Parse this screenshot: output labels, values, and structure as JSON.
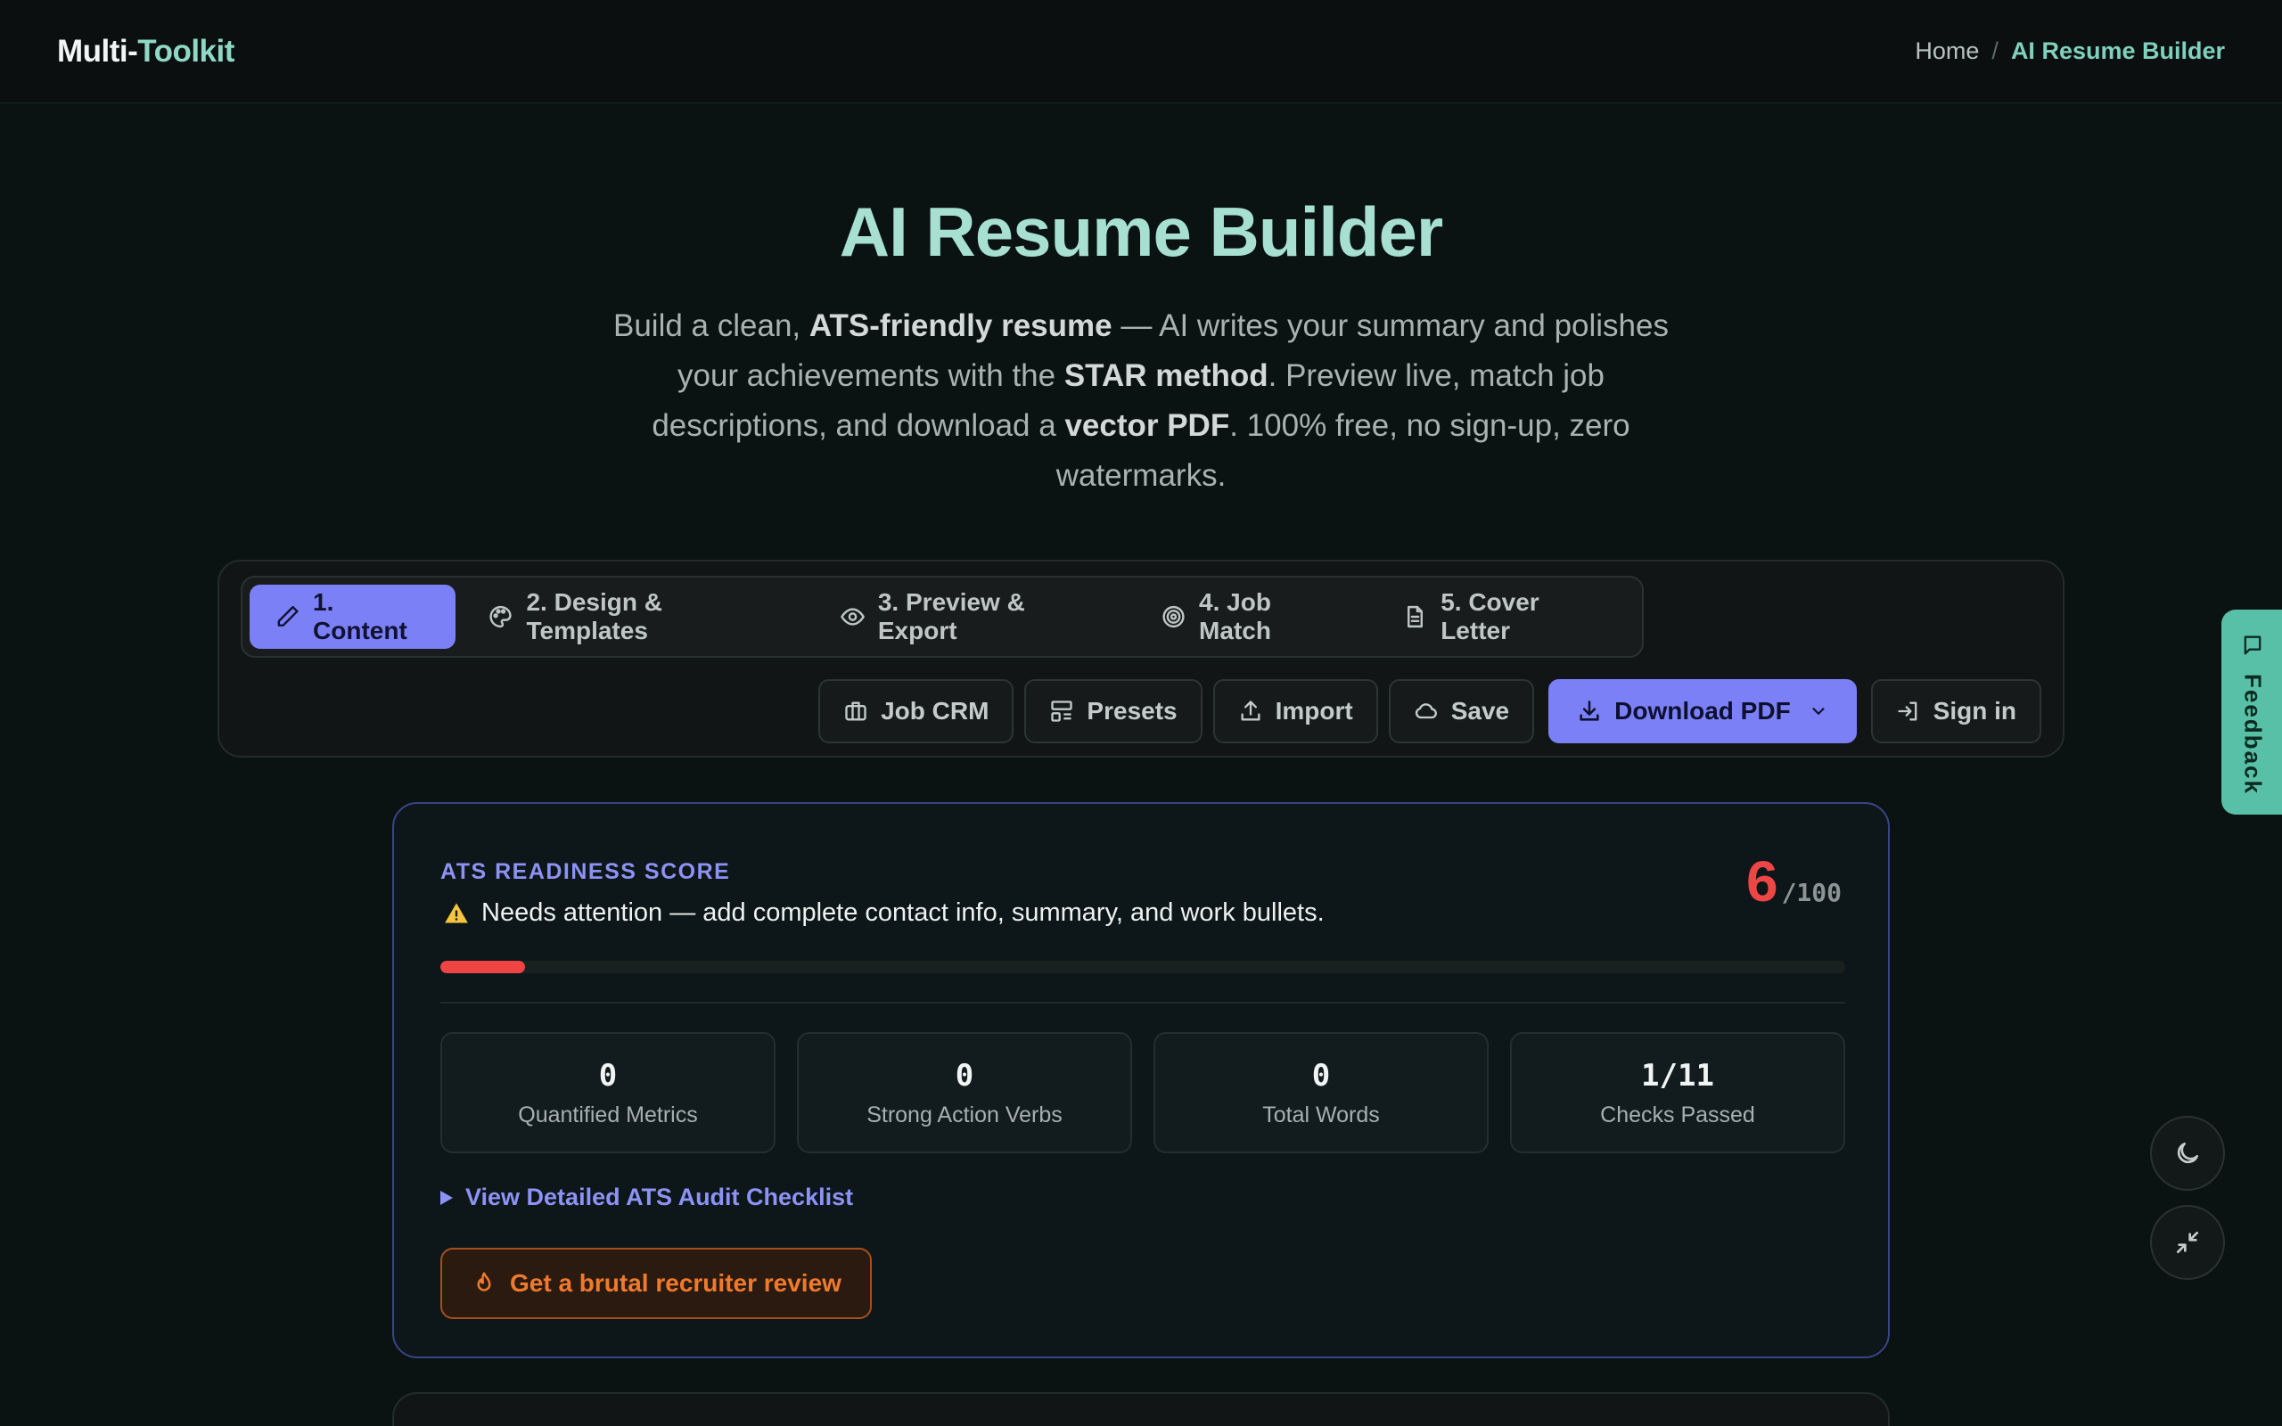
{
  "header": {
    "brand_part1": "Multi-",
    "brand_part2": "Toolkit",
    "breadcrumb_home": "Home",
    "breadcrumb_sep": "/",
    "breadcrumb_current": "AI Resume Builder"
  },
  "hero": {
    "title": "AI Resume Builder",
    "sub_1": "Build a clean, ",
    "sub_b1": "ATS-friendly resume",
    "sub_2": " — AI writes your summary and polishes your achievements with the ",
    "sub_b2": "STAR method",
    "sub_3": ". Preview live, match job descriptions, and download a ",
    "sub_b3": "vector PDF",
    "sub_4": ". 100% free, no sign-up, zero watermarks."
  },
  "tabs": [
    {
      "label": "1. Content",
      "icon": "pencil-icon"
    },
    {
      "label": "2. Design & Templates",
      "icon": "palette-icon"
    },
    {
      "label": "3. Preview & Export",
      "icon": "eye-icon"
    },
    {
      "label": "4. Job Match",
      "icon": "target-icon"
    },
    {
      "label": "5. Cover Letter",
      "icon": "document-icon"
    }
  ],
  "actions": {
    "job_crm": "Job CRM",
    "presets": "Presets",
    "import": "Import",
    "save": "Save",
    "download_pdf": "Download PDF",
    "sign_in": "Sign in"
  },
  "ats": {
    "label": "ATS READINESS SCORE",
    "message": "Needs attention — add complete contact info, summary, and work bullets.",
    "score": "6",
    "score_max": "/100",
    "progress_percent": 6,
    "stats": [
      {
        "value": "0",
        "label": "Quantified Metrics"
      },
      {
        "value": "0",
        "label": "Strong Action Verbs"
      },
      {
        "value": "0",
        "label": "Total Words"
      },
      {
        "value": "1/11",
        "label": "Checks Passed"
      }
    ],
    "audit_link": "View Detailed ATS Audit Checklist",
    "review_button": "Get a brutal recruiter review"
  },
  "feedback": {
    "label": "Feedback"
  },
  "colors": {
    "accent": "#7c80f7",
    "brand_teal": "#8fd8c6",
    "danger": "#ef4444",
    "warning_orange": "#f07a2c",
    "feedback_bg": "#58c0a6"
  }
}
